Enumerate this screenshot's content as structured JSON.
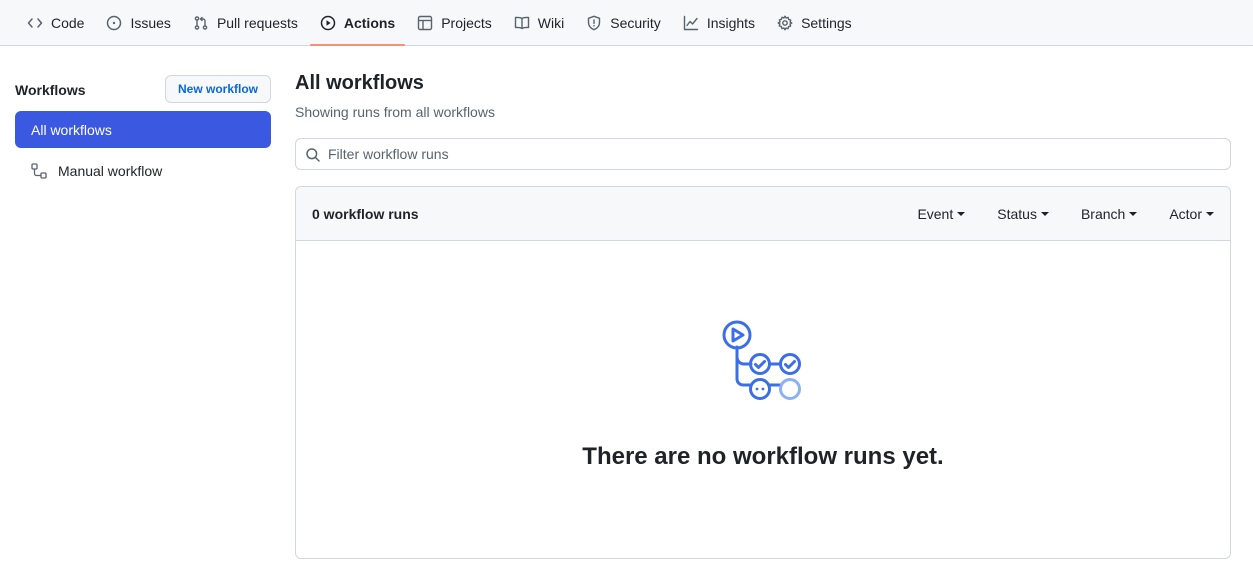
{
  "nav": {
    "items": [
      {
        "label": "Code",
        "icon": "code-icon"
      },
      {
        "label": "Issues",
        "icon": "issue-icon"
      },
      {
        "label": "Pull requests",
        "icon": "pull-request-icon"
      },
      {
        "label": "Actions",
        "icon": "play-icon",
        "selected": true
      },
      {
        "label": "Projects",
        "icon": "table-icon"
      },
      {
        "label": "Wiki",
        "icon": "book-icon"
      },
      {
        "label": "Security",
        "icon": "shield-icon"
      },
      {
        "label": "Insights",
        "icon": "graph-icon"
      },
      {
        "label": "Settings",
        "icon": "gear-icon"
      }
    ],
    "accent_color": "#fd8c73"
  },
  "sidebar": {
    "title": "Workflows",
    "new_button": "New workflow",
    "items": [
      {
        "label": "All workflows",
        "active": true
      },
      {
        "label": "Manual workflow",
        "icon": "workflow-icon"
      }
    ],
    "active_color": "#3b58e0"
  },
  "main": {
    "title": "All workflows",
    "subtitle": "Showing runs from all workflows",
    "filter_placeholder": "Filter workflow runs",
    "runs_count": "0 workflow runs",
    "filters": [
      "Event",
      "Status",
      "Branch",
      "Actor"
    ],
    "empty_message": "There are no workflow runs yet.",
    "illustration_icon": "workflow-runs-illustration"
  }
}
